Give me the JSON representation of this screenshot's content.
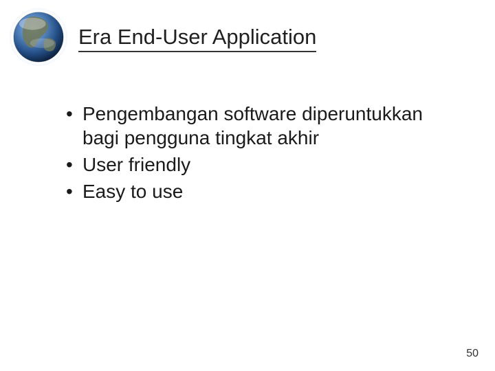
{
  "slide": {
    "title": "Era End-User Application",
    "bullets": [
      "Pengembangan software diperuntukkan bagi pengguna tingkat akhir",
      "User friendly",
      "Easy to use"
    ],
    "page_number": "50"
  }
}
